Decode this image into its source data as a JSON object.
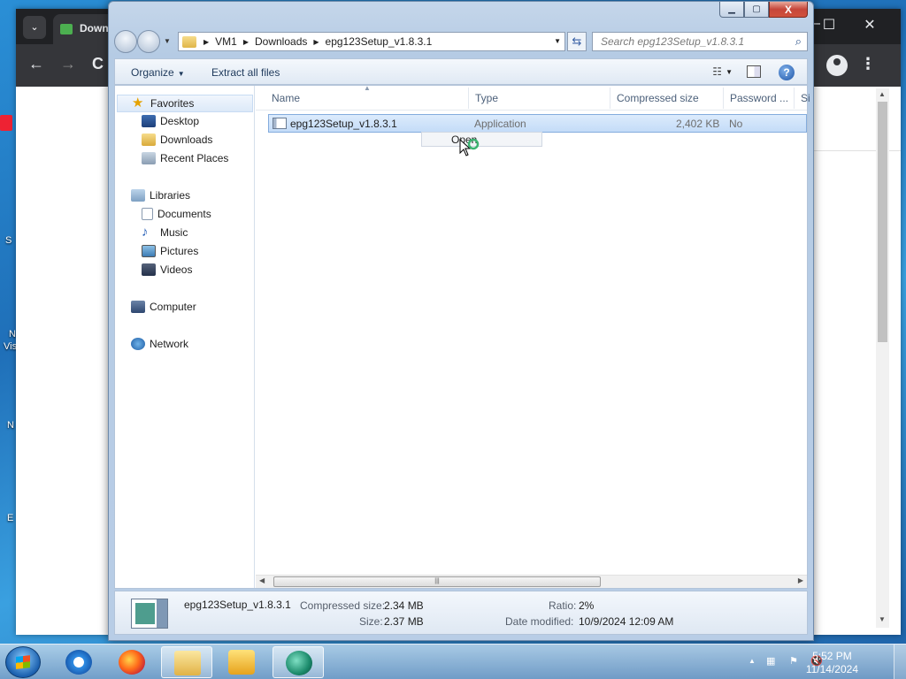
{
  "desktop": {
    "labels": [
      "S",
      "N",
      "Vis",
      "N",
      "E"
    ]
  },
  "browser": {
    "tab_title": "Down",
    "tab_menu_icon": "chevron-down-icon",
    "window_controls": [
      "—",
      "☐",
      "✕"
    ],
    "nav": {
      "back": "←",
      "forward": "→",
      "reload": "C"
    }
  },
  "explorer": {
    "caption": {
      "minimize": "▁",
      "maximize": "▢",
      "close": "X"
    },
    "address": {
      "crumbs": [
        "VM1",
        "Downloads",
        "epg123Setup_v1.8.3.1"
      ]
    },
    "search": {
      "placeholder": "Search epg123Setup_v1.8.3.1"
    },
    "commands": {
      "organize": "Organize",
      "extract": "Extract all files"
    },
    "nav_pane": {
      "favorites": "Favorites",
      "desktop": "Desktop",
      "downloads": "Downloads",
      "recent": "Recent Places",
      "libraries": "Libraries",
      "documents": "Documents",
      "music": "Music",
      "pictures": "Pictures",
      "videos": "Videos",
      "computer": "Computer",
      "network": "Network"
    },
    "columns": {
      "name": "Name",
      "type": "Type",
      "compressed": "Compressed size",
      "password": "Password ...",
      "size": "Si"
    },
    "file": {
      "name": "epg123Setup_v1.8.3.1",
      "type": "Application",
      "compressed": "2,402 KB",
      "password": "No"
    },
    "context_menu": {
      "open": "Open"
    },
    "details": {
      "name": "epg123Setup_v1.8.3.1",
      "compressed_label": "Compressed size:",
      "compressed_value": "2.34 MB",
      "size_label": "Size:",
      "size_value": "2.37 MB",
      "ratio_label": "Ratio:",
      "ratio_value": "2%",
      "modified_label": "Date modified:",
      "modified_value": "10/9/2024 12:09 AM"
    }
  },
  "taskbar": {
    "time": "5:52 PM",
    "date": "11/14/2024",
    "apps": [
      "internet-explorer",
      "firefox",
      "file-explorer",
      "media-player",
      "app"
    ]
  },
  "colors": {
    "selection": "#c4dcf8",
    "close_red": "#c6463a",
    "explorer_frame": "#b5cbe4"
  }
}
